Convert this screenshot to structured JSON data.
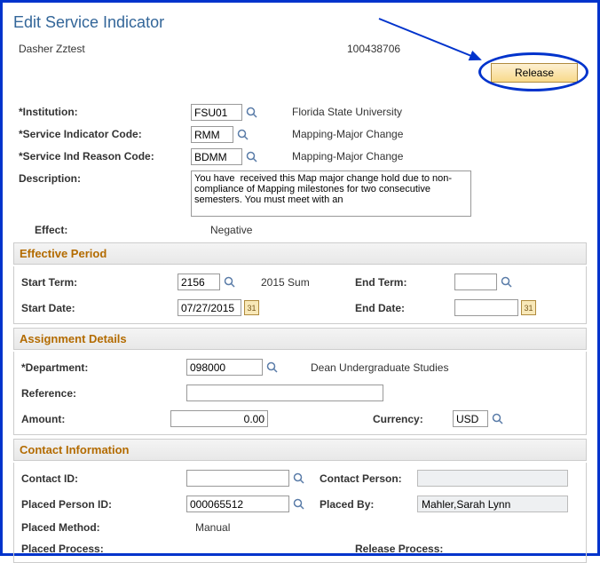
{
  "page_title": "Edit Service Indicator",
  "student": {
    "name": "Dasher Zztest",
    "id": "100438706"
  },
  "buttons": {
    "release": "Release"
  },
  "fields": {
    "institution_label": "*Institution:",
    "institution_value": "FSU01",
    "institution_display": "Florida State University",
    "svc_code_label": "*Service Indicator Code:",
    "svc_code_value": "RMM",
    "svc_code_display": "Mapping-Major Change",
    "reason_label": "*Service Ind Reason Code:",
    "reason_value": "BDMM",
    "reason_display": "Mapping-Major Change",
    "desc_label": "Description:",
    "desc_value": "You have  received this Map major change hold due to non-compliance of Mapping milestones for two consecutive semesters. You must meet with an",
    "effect_label": "Effect:",
    "effect_value": "Negative"
  },
  "eff_period": {
    "header": "Effective Period",
    "start_term_label": "Start Term:",
    "start_term_value": "2156",
    "start_term_display": "2015 Sum",
    "end_term_label": "End Term:",
    "end_term_value": "",
    "start_date_label": "Start Date:",
    "start_date_value": "07/27/2015",
    "end_date_label": "End Date:",
    "end_date_value": ""
  },
  "assignment": {
    "header": "Assignment Details",
    "dept_label": "*Department:",
    "dept_value": "098000",
    "dept_display": "Dean Undergraduate Studies",
    "ref_label": "Reference:",
    "ref_value": "",
    "amount_label": "Amount:",
    "amount_value": "0.00",
    "currency_label": "Currency:",
    "currency_value": "USD"
  },
  "contact": {
    "header": "Contact Information",
    "contact_id_label": "Contact ID:",
    "contact_id_value": "",
    "contact_person_label": "Contact Person:",
    "contact_person_value": "",
    "placed_id_label": "Placed Person ID:",
    "placed_id_value": "000065512",
    "placed_by_label": "Placed By:",
    "placed_by_value": "Mahler,Sarah Lynn",
    "placed_method_label": "Placed Method:",
    "placed_method_value": "Manual",
    "placed_process_label": "Placed Process:",
    "release_process_label": "Release Process:"
  }
}
